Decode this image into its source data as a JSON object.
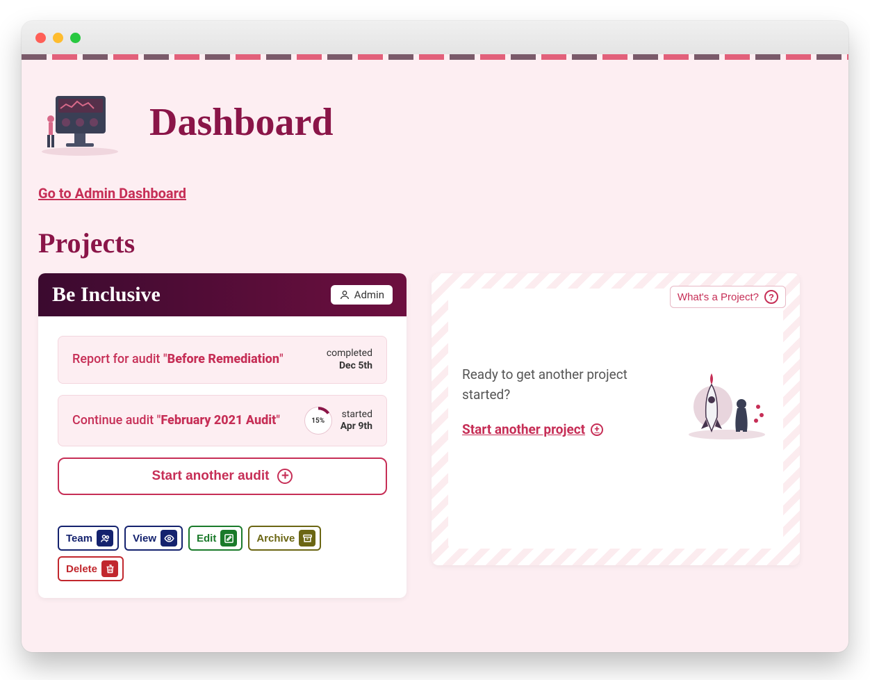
{
  "page": {
    "title": "Dashboard",
    "admin_link": "Go to Admin Dashboard",
    "projects_heading": "Projects"
  },
  "project": {
    "name": "Be Inclusive",
    "role_badge": "Admin",
    "audits": [
      {
        "prefix": "Report for audit \"",
        "name": "Before Remediation",
        "suffix": "\"",
        "state": "completed",
        "date": "Dec 5th",
        "progress": null
      },
      {
        "prefix": "Continue audit \"",
        "name": "February 2021 Audit",
        "suffix": "\"",
        "state": "started",
        "date": "Apr 9th",
        "progress": "15%"
      }
    ],
    "start_audit_label": "Start another audit",
    "actions": {
      "team": "Team",
      "view": "View",
      "edit": "Edit",
      "archive": "Archive",
      "delete": "Delete"
    }
  },
  "new_project": {
    "help_label": "What's a Project?",
    "ready_text": "Ready to get another project started?",
    "start_label": "Start another project"
  }
}
